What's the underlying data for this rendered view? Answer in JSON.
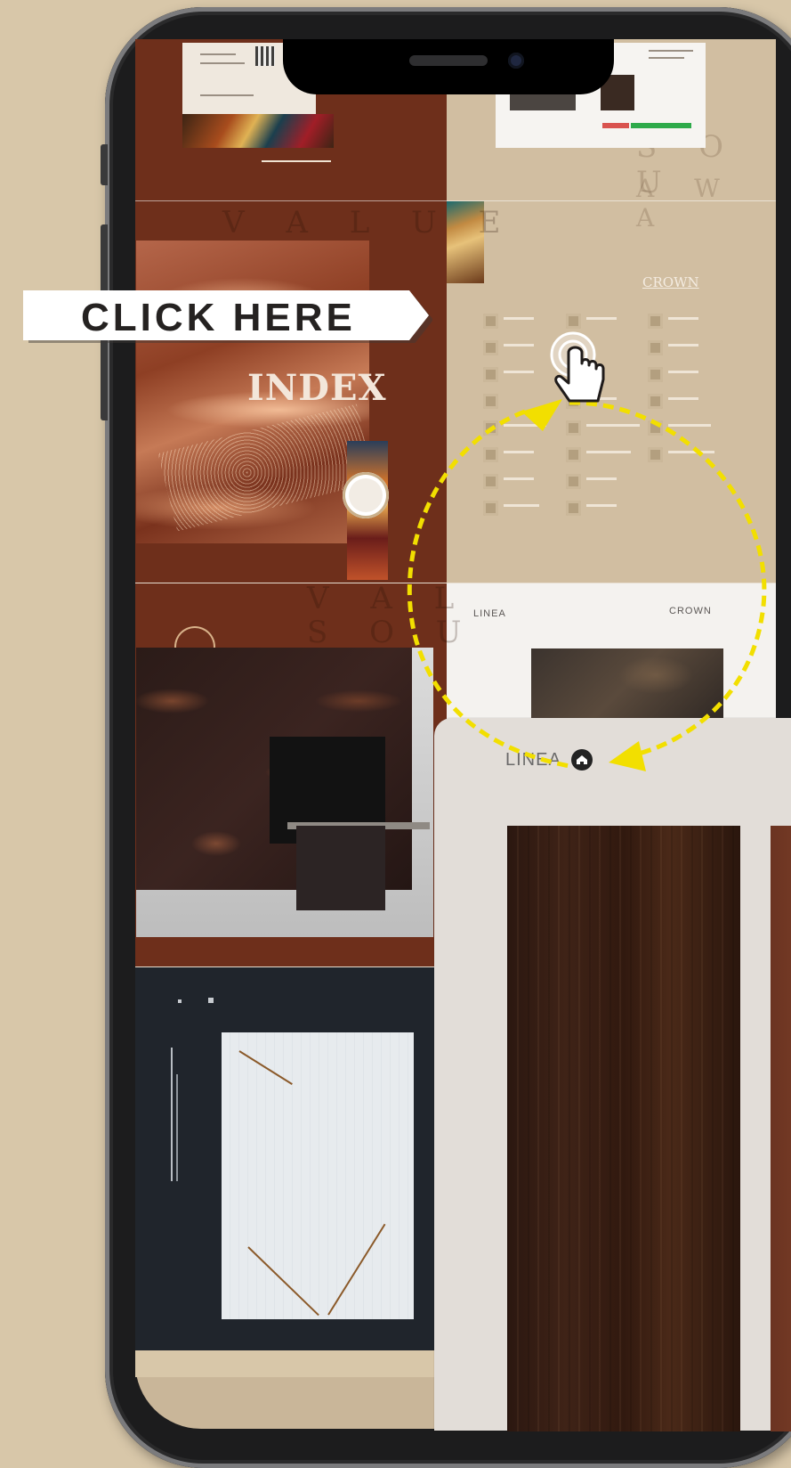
{
  "callout": {
    "label": "CLICK HERE"
  },
  "index_tile": {
    "title": "INDEX",
    "brand_label": "CROWN"
  },
  "panel": {
    "label": "LINEA",
    "icon": "home-icon"
  },
  "linea_tile": {
    "left_label": "LINEA",
    "right_label": "CROWN"
  },
  "colors": {
    "accent_arrow": "#f2df00",
    "brown": "#6e2f1b",
    "beige": "#d1bea1",
    "dark_tile": "#20252c"
  }
}
